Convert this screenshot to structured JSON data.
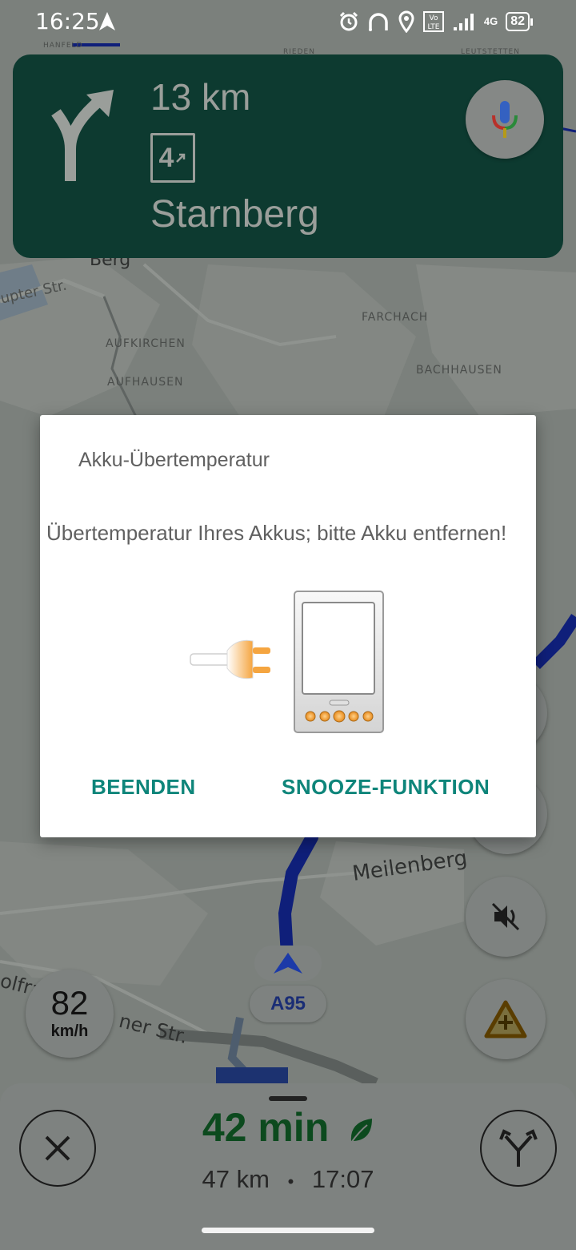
{
  "status_bar": {
    "time": "16:25",
    "network": "4G",
    "battery": "82",
    "icons": [
      "navigation-arrow-icon",
      "alarm-icon",
      "headphones-icon",
      "location-pin-icon",
      "volte-icon",
      "signal-icon",
      "battery-icon"
    ]
  },
  "navigation": {
    "distance": "13 km",
    "exit_number": "4",
    "destination": "Starnberg",
    "maneuver": "turn-slight-right"
  },
  "map": {
    "labels": {
      "hanfeld": "HANFELD",
      "rieden": "RIEDEN",
      "leutstetten": "LEUTSTETTEN",
      "berg": "Berg",
      "hauptstr": "upter Str.",
      "farchach": "FARCHACH",
      "aufkirchen": "AUFKIRCHEN",
      "aufhausen": "AUFHAUSEN",
      "bachhausen": "BACHHAUSEN",
      "meilenberg": "Meilenberg",
      "wolfra": "olfra",
      "nerstr": "ner Str."
    },
    "road_shield": "A95",
    "speed_value": "82",
    "speed_unit": "km/h"
  },
  "bottom_panel": {
    "eta_duration": "42 min",
    "distance": "47 km",
    "separator": "•",
    "arrival_time": "17:07"
  },
  "dialog": {
    "title": "Akku-Übertemperatur",
    "message": "Übertemperatur Ihres Akkus; bitte Akku entfernen!",
    "button_quit": "BEENDEN",
    "button_snooze": "SNOOZE-FUNKTION",
    "accent_color": "#0e857a"
  },
  "colors": {
    "nav_card": "#0d3a30",
    "eta_green": "#0c4a1e",
    "route_blue": "#1a2d75"
  }
}
